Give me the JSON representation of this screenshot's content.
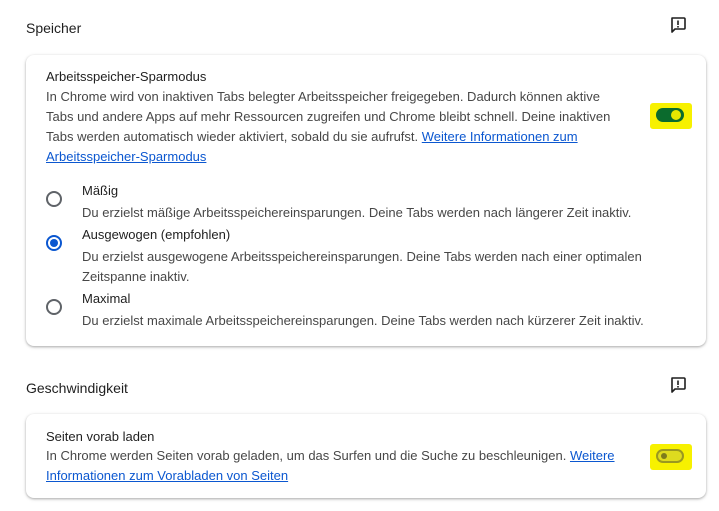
{
  "speicher": {
    "section_title": "Speicher",
    "memory_saver": {
      "title": "Arbeitsspeicher-Sparmodus",
      "description": "In Chrome wird von inaktiven Tabs belegter Arbeitsspeicher freigegeben. Dadurch können aktive Tabs und andere Apps auf mehr Ressourcen zugreifen und Chrome bleibt schnell. Deine inaktiven Tabs werden automatisch wieder aktiviert, sobald du sie aufrufst.",
      "link": "Weitere Informationen zum Arbeitsspeicher-Sparmodus",
      "toggle_on": true
    },
    "options": [
      {
        "label": "Mäßig",
        "description": "Du erzielst mäßige Arbeitsspeichereinsparungen. Deine Tabs werden nach längerer Zeit inaktiv.",
        "checked": false
      },
      {
        "label": "Ausgewogen (empfohlen)",
        "description": "Du erzielst ausgewogene Arbeitsspeichereinsparungen. Deine Tabs werden nach einer optimalen Zeitspanne inaktiv.",
        "checked": true
      },
      {
        "label": "Maximal",
        "description": "Du erzielst maximale Arbeitsspeichereinsparungen. Deine Tabs werden nach kürzerer Zeit inaktiv.",
        "checked": false
      }
    ]
  },
  "geschwindigkeit": {
    "section_title": "Geschwindigkeit",
    "preload": {
      "title": "Seiten vorab laden",
      "description": "In Chrome werden Seiten vorab geladen, um das Surfen und die Suche zu beschleunigen.",
      "link": "Weitere Informationen zum Vorabladen von Seiten",
      "toggle_on": false
    }
  },
  "icons": {
    "feedback": "feedback-icon"
  },
  "colors": {
    "accent": "#0b57d0",
    "toggle_on": "#0b6b2d",
    "highlight": "#f7f100"
  }
}
